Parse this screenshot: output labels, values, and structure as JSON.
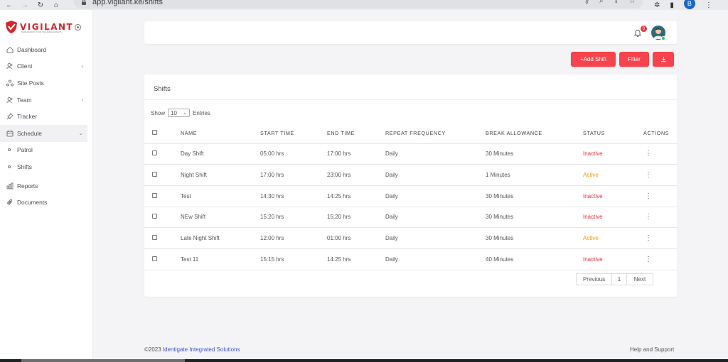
{
  "browser": {
    "url": "app.vigilant.ke/shifts",
    "profile_initial": "B"
  },
  "brand": {
    "name": "VIGILANT",
    "tagline": "SAFEGUARD YOUR VALUABLE ASSETS",
    "accent": "#d4242b"
  },
  "sidebar": {
    "items": [
      {
        "label": "Dashboard",
        "icon": "home-icon"
      },
      {
        "label": "Client",
        "icon": "users-icon",
        "has_children": true
      },
      {
        "label": "Site Posts",
        "icon": "sitemap-icon"
      },
      {
        "label": "Team",
        "icon": "team-icon",
        "has_children": true
      },
      {
        "label": "Tracker",
        "icon": "pin-icon"
      },
      {
        "label": "Schedule",
        "icon": "calendar-icon",
        "expanded": true
      },
      {
        "label": "Patrol",
        "icon": "dot-icon",
        "sub": true
      },
      {
        "label": "Shifts",
        "icon": "dot-icon",
        "sub": true
      },
      {
        "label": "Reports",
        "icon": "bar-chart-icon"
      },
      {
        "label": "Documents",
        "icon": "paperclip-icon"
      }
    ]
  },
  "header": {
    "notification_count": "0"
  },
  "actions": {
    "add_label": "+Add Shift",
    "filter_label": "Filter"
  },
  "shifts": {
    "title": "Shifts",
    "show_label": "Show",
    "page_size": "10",
    "entries_label": "Entries",
    "columns": [
      "NAME",
      "START TIME",
      "END TIME",
      "REPEAT FREQUENCY",
      "BREAK ALLOWANCE",
      "STATUS",
      "ACTIONS"
    ],
    "rows": [
      {
        "name": "Day Shift",
        "start": "05:00 hrs",
        "end": "17:00 hrs",
        "repeat": "Daily",
        "break": "30 Minutes",
        "status": "Inactive"
      },
      {
        "name": "Night Shift",
        "start": "17:00 hrs",
        "end": "23:00 hrs",
        "repeat": "Daily",
        "break": "1 Minutes",
        "status": "Active"
      },
      {
        "name": "Test",
        "start": "14:30 hrs",
        "end": "14:25 hrs",
        "repeat": "Daily",
        "break": "30 Minutes",
        "status": "Inactive"
      },
      {
        "name": "NEw Shift",
        "start": "15:20 hrs",
        "end": "15:20 hrs",
        "repeat": "Daily",
        "break": "30 Minutes",
        "status": "Inactive"
      },
      {
        "name": "Late Night Shift",
        "start": "12:00 hrs",
        "end": "01:00 hrs",
        "repeat": "Daily",
        "break": "30 Minutes",
        "status": "Active"
      },
      {
        "name": "Test 11",
        "start": "15:15 hrs",
        "end": "14:25 hrs",
        "repeat": "Daily",
        "break": "40 Minutes",
        "status": "Inactive"
      }
    ],
    "pagination": {
      "previous": "Previous",
      "page": "1",
      "next": "Next"
    }
  },
  "footer": {
    "copyright": "©2023",
    "company": "Identigate Integrated Solutions",
    "help": "Help and Support"
  },
  "colors": {
    "primary_button": "#f6434c",
    "inactive": "#e8333c",
    "active": "#f19b0b",
    "link": "#3b54d6"
  }
}
